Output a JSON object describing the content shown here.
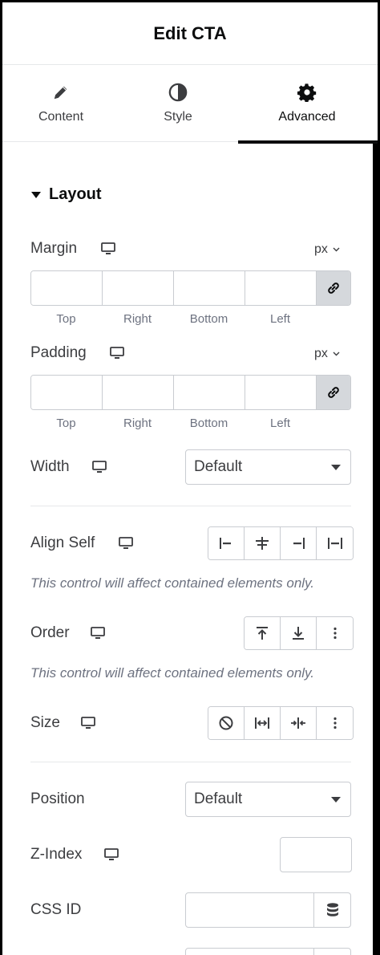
{
  "header": {
    "title": "Edit CTA"
  },
  "tabs": [
    {
      "label": "Content",
      "icon": "pencil-icon"
    },
    {
      "label": "Style",
      "icon": "half-circle-icon"
    },
    {
      "label": "Advanced",
      "icon": "gear-icon",
      "active": true
    }
  ],
  "section": {
    "title": "Layout"
  },
  "margin": {
    "label": "Margin",
    "unit": "px",
    "sides": [
      "Top",
      "Right",
      "Bottom",
      "Left"
    ]
  },
  "padding": {
    "label": "Padding",
    "unit": "px",
    "sides": [
      "Top",
      "Right",
      "Bottom",
      "Left"
    ]
  },
  "width": {
    "label": "Width",
    "value": "Default"
  },
  "align_self": {
    "label": "Align Self",
    "note": "This control will affect contained elements only."
  },
  "order": {
    "label": "Order",
    "note": "This control will affect contained elements only."
  },
  "size": {
    "label": "Size"
  },
  "position": {
    "label": "Position",
    "value": "Default"
  },
  "z_index": {
    "label": "Z-Index"
  },
  "css_id": {
    "label": "CSS ID"
  },
  "colors": {
    "text": "#3c3d40",
    "heading": "#0c0d0e",
    "border": "#c9ccd1",
    "muted": "#6d7280",
    "link_bg": "#d5d8dc"
  }
}
